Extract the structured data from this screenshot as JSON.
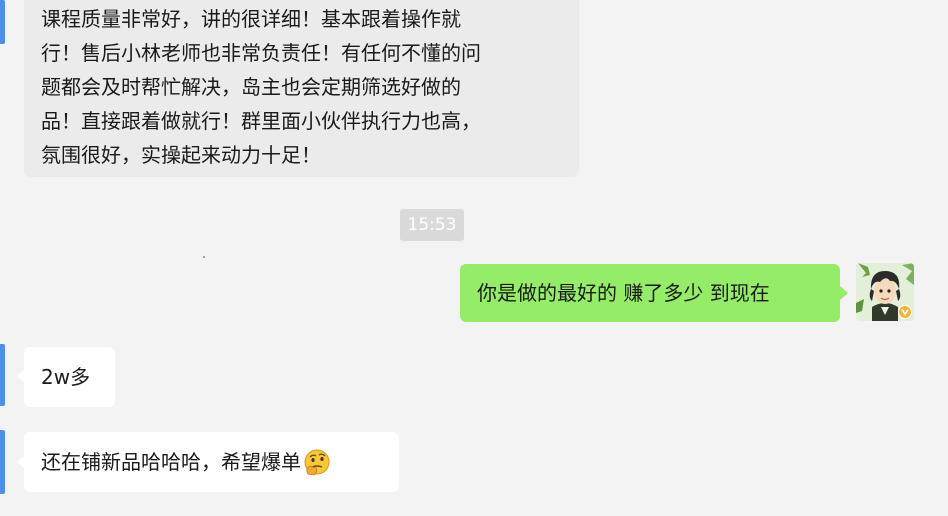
{
  "messages": [
    {
      "lines": [
        "课程质量非常好，讲的很详细！基本跟着操作就",
        "行！售后小林老师也非常负责任！有任何不懂的问",
        "题都会及时帮忙解决，岛主也会定期筛选好做的",
        "品！直接跟着做就行！群里面小伙伴执行力也高，",
        "氛围很好，实操起来动力十足！"
      ]
    },
    {
      "text": "你是做的最好的 赚了多少 到现在"
    },
    {
      "text": "2w多"
    },
    {
      "text": "还在铺新品哈哈哈，希望爆单",
      "emoji": "thinking-face-emoji"
    }
  ],
  "timestamp": "15:53",
  "avatar": {
    "badge_icon": "vip-badge-icon"
  },
  "colors": {
    "background": "#f3f3f3",
    "sent_bubble": "#95ec69",
    "received_bubble": "#ffffff",
    "edge_bar": "#4d8ee8",
    "timestamp_bg": "#dadada"
  }
}
